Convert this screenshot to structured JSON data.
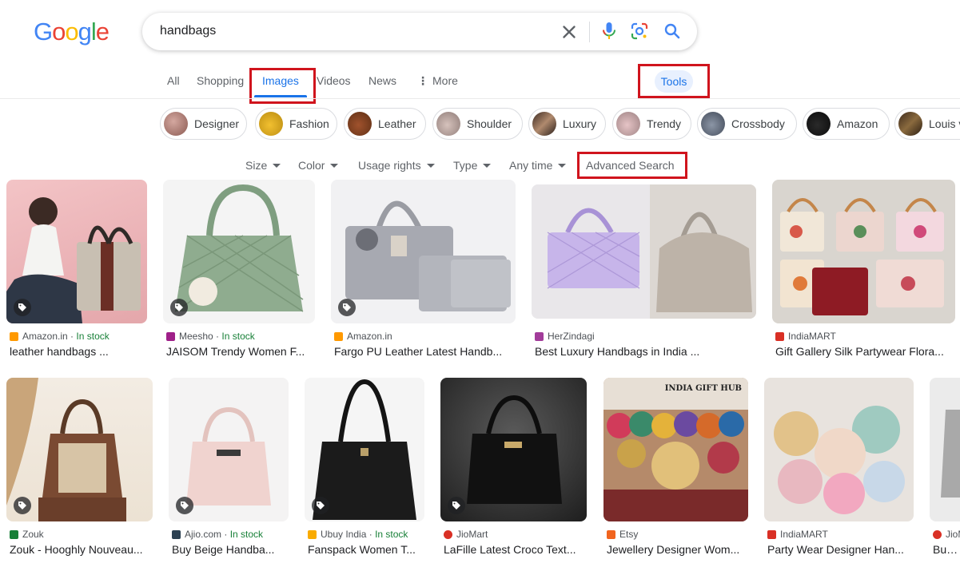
{
  "logo": {
    "letters": [
      "G",
      "o",
      "o",
      "g",
      "l",
      "e"
    ],
    "colors": [
      "#4285f4",
      "#ea4335",
      "#fbbc05",
      "#4285f4",
      "#34a853",
      "#ea4335"
    ]
  },
  "search": {
    "query": "handbags"
  },
  "tabs": [
    {
      "label": "All",
      "active": false
    },
    {
      "label": "Shopping",
      "active": false
    },
    {
      "label": "Images",
      "active": true
    },
    {
      "label": "Videos",
      "active": false
    },
    {
      "label": "News",
      "active": false
    },
    {
      "label": "More",
      "active": false
    }
  ],
  "tools": {
    "label": "Tools"
  },
  "chips": [
    "Designer",
    "Fashion",
    "Leather",
    "Shoulder",
    "Luxury",
    "Trendy",
    "Crossbody",
    "Amazon",
    "Louis v"
  ],
  "filters": [
    "Size",
    "Color",
    "Usage rights",
    "Type",
    "Any time"
  ],
  "advanced_search": {
    "label": "Advanced Search"
  },
  "results": [
    {
      "source": "Amazon.in",
      "stock": "In stock",
      "title": "leather handbags ...",
      "favicon_color": "#ff9900"
    },
    {
      "source": "Meesho",
      "stock": "In stock",
      "title": "JAISOM Trendy Women F...",
      "favicon_color": "#9f2089"
    },
    {
      "source": "Amazon.in",
      "stock": "",
      "title": "Fargo PU Leather Latest Handb...",
      "favicon_color": "#ff9900"
    },
    {
      "source": "HerZindagi",
      "stock": "",
      "title": "Best Luxury Handbags in India ...",
      "favicon_color": "#a23c9a"
    },
    {
      "source": "IndiaMART",
      "stock": "",
      "title": "Gift Gallery Silk Partywear Flora...",
      "favicon_color": "#d93025"
    },
    {
      "source": "Zouk",
      "stock": "",
      "title": "Zouk - Hooghly Nouveau...",
      "favicon_color": "#188038"
    },
    {
      "source": "Ajio.com",
      "stock": "In stock",
      "title": "Buy Beige Handba...",
      "favicon_color": "#2c4152"
    },
    {
      "source": "Ubuy India",
      "stock": "In stock",
      "title": "Fanspack Women T...",
      "favicon_color": "#f9ab00"
    },
    {
      "source": "JioMart",
      "stock": "",
      "title": "LaFille Latest Croco Text...",
      "favicon_color": "#d93025"
    },
    {
      "source": "Etsy",
      "stock": "",
      "title": "Jewellery Designer Wom...",
      "favicon_color": "#f1641e"
    },
    {
      "source": "IndiaMART",
      "stock": "",
      "title": "Party Wear Designer Han...",
      "favicon_color": "#d93025"
    },
    {
      "source": "JioM",
      "stock": "",
      "title": "Buy S",
      "favicon_color": "#d93025"
    }
  ],
  "stock_separator": "·",
  "image_caption_text": "INDIA GIFT HUB",
  "accent_color": "#1a73e8",
  "highlight_color": "#d0141d"
}
